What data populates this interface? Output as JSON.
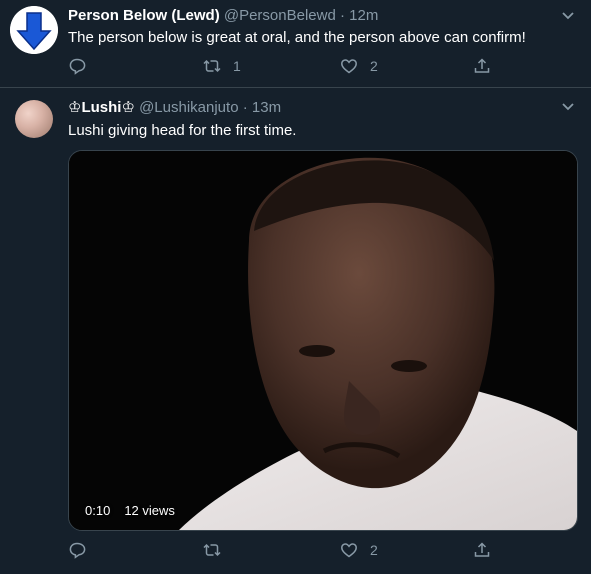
{
  "tweets": [
    {
      "name": "Person Below (Lewd)",
      "handle": "@PersonBelewd",
      "separator": "·",
      "time": "12m",
      "text": "The person below is great at oral, and the person above can confirm!",
      "retweets": "1",
      "likes": "2",
      "avatar_icon": "down-arrow-icon"
    },
    {
      "name": "♔Lushi♔",
      "handle": "@Lushikanjuto",
      "separator": "·",
      "time": "13m",
      "text": "Lushi giving head for the first time.",
      "retweets": "",
      "likes": "2",
      "video": {
        "duration": "0:10",
        "views": "12 views"
      }
    }
  ],
  "colors": {
    "background": "#15202b",
    "secondary_text": "#8899a6",
    "avatar_arrow": "#1a58d6",
    "divider": "#38444d"
  }
}
